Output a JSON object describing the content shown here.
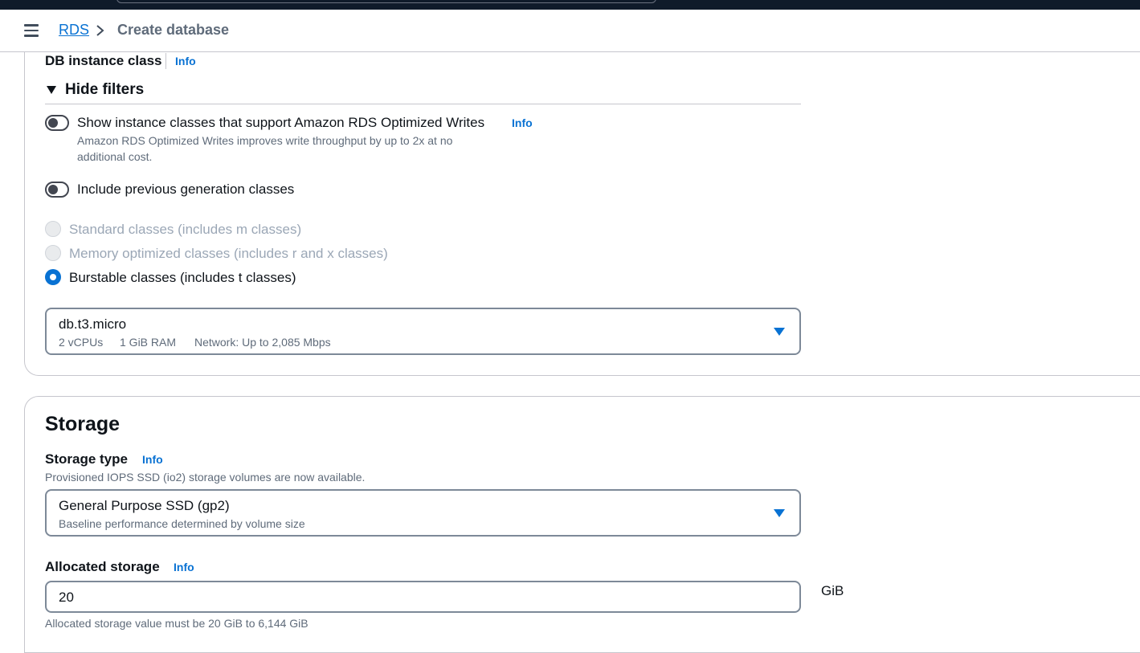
{
  "breadcrumb": {
    "root": "RDS",
    "current": "Create database"
  },
  "instance_class": {
    "label": "DB instance class",
    "info": "Info",
    "filters_toggle": "Hide filters",
    "toggles": [
      {
        "label": "Show instance classes that support Amazon RDS Optimized Writes",
        "info": "Info",
        "desc_line1": "Amazon RDS Optimized Writes improves write throughput by up to 2x at no",
        "desc_line2": "additional cost.",
        "on": false
      },
      {
        "label": "Include previous generation classes",
        "on": false
      }
    ],
    "radios": [
      {
        "label": "Standard classes (includes m classes)",
        "state": "disabled"
      },
      {
        "label": "Memory optimized classes (includes r and x classes)",
        "state": "disabled"
      },
      {
        "label": "Burstable classes (includes t classes)",
        "state": "selected"
      }
    ],
    "select": {
      "value": "db.t3.micro",
      "vcpus": "2 vCPUs",
      "ram": "1 GiB RAM",
      "network": "Network: Up to 2,085 Mbps"
    }
  },
  "storage": {
    "title": "Storage",
    "type_label": "Storage type",
    "type_info": "Info",
    "type_desc": "Provisioned IOPS SSD (io2) storage volumes are now available.",
    "type_select": {
      "value": "General Purpose SSD (gp2)",
      "desc": "Baseline performance determined by volume size"
    },
    "alloc_label": "Allocated storage",
    "alloc_info": "Info",
    "alloc_value": "20",
    "alloc_unit": "GiB",
    "alloc_hint": "Allocated storage value must be 20 GiB to 6,144 GiB"
  },
  "colors": {
    "accent": "#0972d3",
    "text": "#0f141a",
    "muted": "#5f6b7a",
    "border": "#7d8998"
  },
  "icons": [
    "menu-icon",
    "chevron-right-icon",
    "caret-down-icon"
  ]
}
